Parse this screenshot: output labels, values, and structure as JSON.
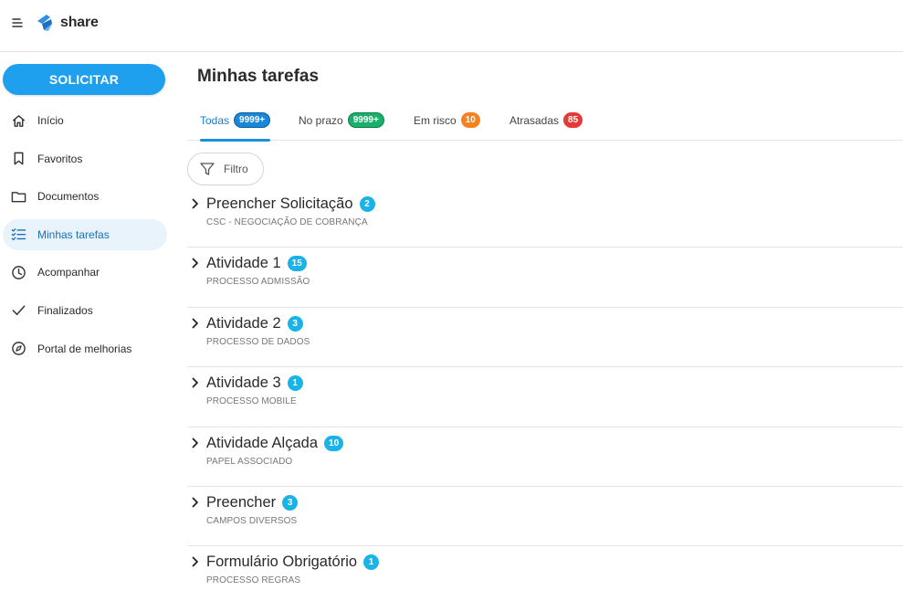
{
  "app": {
    "logo_text": "share"
  },
  "sidebar": {
    "primary_action": "SOLICITAR",
    "items": [
      {
        "label": "Início",
        "icon": "home-icon"
      },
      {
        "label": "Favoritos",
        "icon": "bookmark-icon"
      },
      {
        "label": "Documentos",
        "icon": "folder-icon"
      },
      {
        "label": "Minhas tarefas",
        "icon": "task-list-icon",
        "active": true
      },
      {
        "label": "Acompanhar",
        "icon": "clock-icon"
      },
      {
        "label": "Finalizados",
        "icon": "check-icon"
      },
      {
        "label": "Portal de melhorias",
        "icon": "compass-icon"
      }
    ]
  },
  "main": {
    "title": "Minhas tarefas",
    "tabs": [
      {
        "label": "Todas",
        "count": "9999+",
        "active": true,
        "color": "#1a87d8"
      },
      {
        "label": "No prazo",
        "count": "9999+",
        "color": "#18b06a"
      },
      {
        "label": "Em risco",
        "count": "10",
        "color": "#f58220"
      },
      {
        "label": "Atrasadas",
        "count": "85",
        "color": "#e53935"
      }
    ],
    "filter_label": "Filtro",
    "tasks": [
      {
        "title": "Preencher Solicitação",
        "count": "2",
        "subtitle": "CSC - NEGOCIAÇÃO DE COBRANÇA"
      },
      {
        "title": "Atividade 1",
        "count": "15",
        "subtitle": "PROCESSO ADMISSÃO"
      },
      {
        "title": "Atividade 2",
        "count": "3",
        "subtitle": "PROCESSO DE DADOS"
      },
      {
        "title": "Atividade 3",
        "count": "1",
        "subtitle": "PROCESSO MOBILE"
      },
      {
        "title": "Atividade Alçada",
        "count": "10",
        "subtitle": "PAPEL ASSOCIADO"
      },
      {
        "title": "Preencher",
        "count": "3",
        "subtitle": "CAMPOS DIVERSOS"
      },
      {
        "title": "Formulário Obrigatório",
        "count": "1",
        "subtitle": "PROCESSO REGRAS"
      }
    ]
  },
  "colors": {
    "accent": "#1ea0ee",
    "badge_cyan": "#1ab3e8",
    "active_nav_bg": "#e8f3fc"
  }
}
